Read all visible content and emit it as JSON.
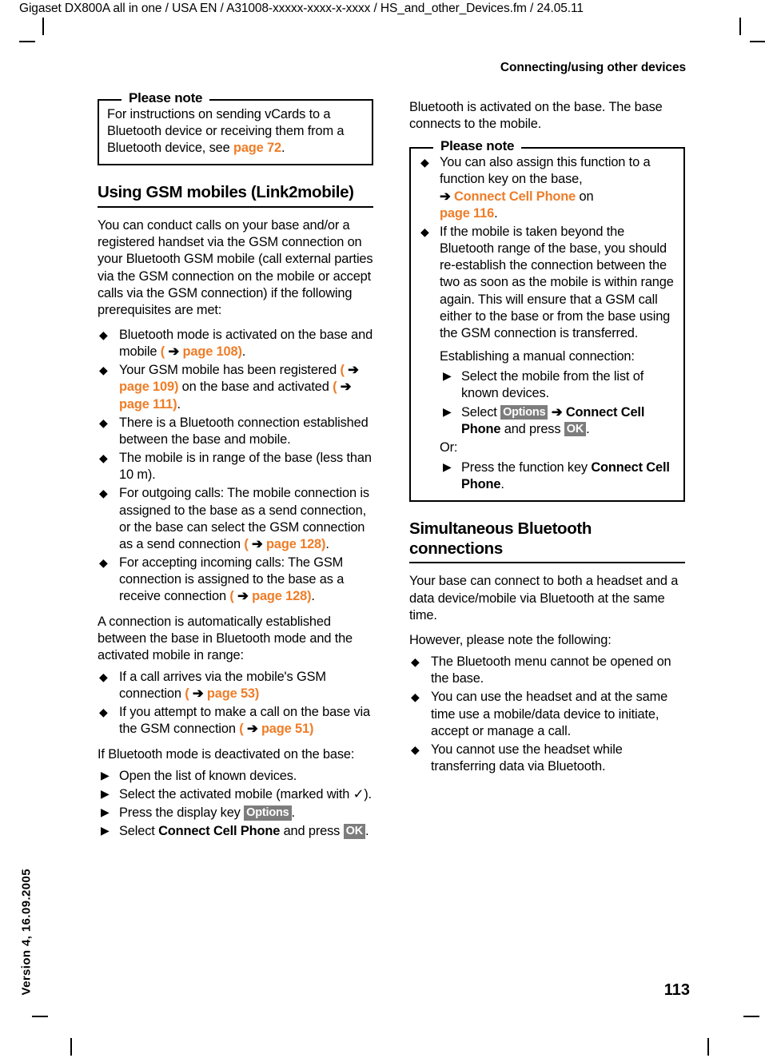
{
  "header": {
    "file_line": "Gigaset DX800A all in one / USA EN / A31008-xxxxx-xxxx-x-xxxx / HS_and_other_Devices.fm / 24.05.11",
    "chapter_title": "Connecting/using other devices"
  },
  "footer": {
    "version_text": "Version 4, 16.09.2005",
    "page_number": "113"
  },
  "left_column": {
    "note_box": {
      "legend": "Please note",
      "text_before": "For instructions on sending vCards to a Bluetooth device or receiving them from a Bluetooth device, see ",
      "link": "page 72",
      "text_after": "."
    },
    "section_heading": "Using GSM mobiles (Link2mobile)",
    "intro": "You can conduct calls on your base and/or a registered handset via the GSM connection on your Bluetooth GSM mobile (call external parties via the GSM connection on the mobile or accept calls via the GSM connection) if the following prerequisites are met:",
    "prereq_items": [
      {
        "pre": "Bluetooth mode is activated on the base and mobile ",
        "ref": "page 108",
        "post": "."
      },
      {
        "pre": "Your GSM mobile has been registered ",
        "ref": "page 109",
        "mid": " on the base and activated ",
        "ref2": "page 111",
        "post": "."
      },
      {
        "pre": "There is a Bluetooth connection established between the base and mobile.",
        "ref": "",
        "post": ""
      },
      {
        "pre": "The mobile is in range of the base (less than 10 m).",
        "ref": "",
        "post": ""
      },
      {
        "pre": "For outgoing calls: The mobile connection is assigned to the base as a send connection, or the base can select the GSM connection as a send connection ",
        "ref": "page 128",
        "post": "."
      },
      {
        "pre": "For accepting incoming calls: The GSM connection is assigned to the base as a receive connection ",
        "ref": "page 128",
        "post": "."
      }
    ],
    "auto_connect_intro": "A connection is automatically established between the base in Bluetooth mode and the activated mobile in range:",
    "auto_connect_items": [
      {
        "pre": "If a call arrives via the mobile's GSM connection ",
        "ref": "page 53",
        "post": ""
      },
      {
        "pre": "If you attempt to make a call on the base via the GSM connection ",
        "ref": "page 51",
        "post": ""
      }
    ],
    "deactivated_intro": "If Bluetooth mode is deactivated on the base:",
    "steps": [
      {
        "text": "Open the list of known devices."
      },
      {
        "text": "Select the activated mobile (marked with ✓)."
      },
      {
        "text": "Press the display key ",
        "key": "Options",
        "after": "."
      },
      {
        "text": "Select ",
        "bold": "Connect Cell Phone",
        "mid": " and press ",
        "key": "OK",
        "after": "."
      }
    ]
  },
  "right_column": {
    "intro": "Bluetooth is activated on the base. The base connects to the mobile.",
    "note_box": {
      "legend": "Please note",
      "items": [
        {
          "pre": "You can also assign this function to a function key on the base,",
          "arrow_label": "Connect Cell Phone",
          "mid": " on ",
          "ref": "page 116",
          "post": "."
        },
        {
          "pre": "If the mobile is taken beyond the Bluetooth range of the base, you should re-establish the connection between the two as soon as the mobile is within range again. This will ensure that a GSM call either to the base or from the base using the GSM connection is transferred."
        }
      ],
      "manual_intro": "Establishing a manual connection:",
      "manual_steps": [
        {
          "text": "Select the mobile from the list of known devices."
        },
        {
          "pre": "Select ",
          "key1": "Options",
          "mid": " ➔ ",
          "bold": "Connect Cell Phone",
          "mid2": " and press ",
          "key2": "OK",
          "after": "."
        }
      ],
      "or_label": "Or:",
      "or_steps": [
        {
          "pre": "Press the function key ",
          "bold": "Connect Cell Phone",
          "after": "."
        }
      ]
    },
    "section_heading": "Simultaneous Bluetooth connections",
    "para1": "Your base can connect to both a headset and a data device/mobile via Bluetooth at the same time.",
    "para2": "However, please note the following:",
    "bullets": [
      "The Bluetooth menu cannot be opened on the base.",
      "You can use the headset and at the same time use a mobile/data device to initiate, accept or manage a call.",
      "You cannot use the headset while transferring data via Bluetooth."
    ]
  },
  "icons": {
    "diamond_bullet": "◆",
    "triangle_bullet": "▶",
    "arrow": "➔",
    "checkmark": "✓"
  },
  "colors": {
    "link_orange": "#EE7D28",
    "key_badge_gray": "#7d7d7d",
    "text_black": "#000000"
  }
}
